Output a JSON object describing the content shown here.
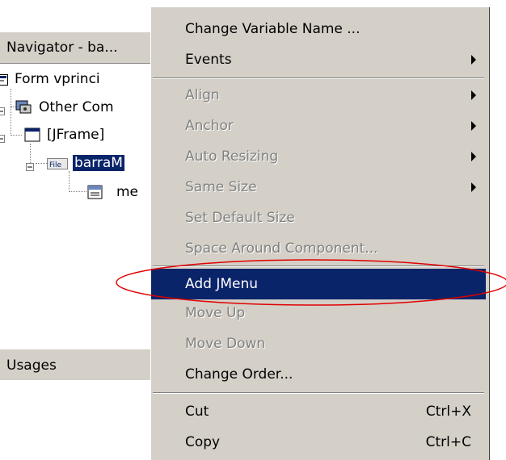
{
  "navigator": {
    "title": "Navigator - ba...",
    "tree": [
      {
        "label": "Form vprinci",
        "icon": "form-icon"
      },
      {
        "label": "Other Com",
        "icon": "other-components-icon"
      },
      {
        "label": "[JFrame]",
        "icon": "jframe-icon"
      },
      {
        "label": "barraM",
        "icon": "menubar-file-icon",
        "icon_text": "File",
        "selected": true
      },
      {
        "label": "me",
        "icon": "menu-icon"
      }
    ]
  },
  "usages": {
    "title": "Usages"
  },
  "context_menu": {
    "items": [
      {
        "label": "Change Variable Name ...",
        "enabled": true,
        "submenu": false
      },
      {
        "label": "Events",
        "enabled": true,
        "submenu": true
      },
      {
        "label": "Align",
        "enabled": false,
        "submenu": true
      },
      {
        "label": "Anchor",
        "enabled": false,
        "submenu": true
      },
      {
        "label": "Auto Resizing",
        "enabled": false,
        "submenu": true
      },
      {
        "label": "Same Size",
        "enabled": false,
        "submenu": true
      },
      {
        "label": "Set Default Size",
        "enabled": false,
        "submenu": false
      },
      {
        "label": "Space Around Component...",
        "enabled": false,
        "submenu": false
      },
      {
        "label": "Add JMenu",
        "enabled": true,
        "submenu": false,
        "highlighted": true
      },
      {
        "label": "Move Up",
        "enabled": false,
        "submenu": false
      },
      {
        "label": "Move Down",
        "enabled": false,
        "submenu": false
      },
      {
        "label": "Change Order...",
        "enabled": true,
        "submenu": false
      },
      {
        "label": "Cut",
        "enabled": true,
        "shortcut": "Ctrl+X"
      },
      {
        "label": "Copy",
        "enabled": true,
        "shortcut": "Ctrl+C"
      }
    ]
  },
  "colors": {
    "menu_bg": "#d4d0c8",
    "highlight": "#0a246a",
    "annotation": "#e00000",
    "disabled_text": "#808080"
  }
}
